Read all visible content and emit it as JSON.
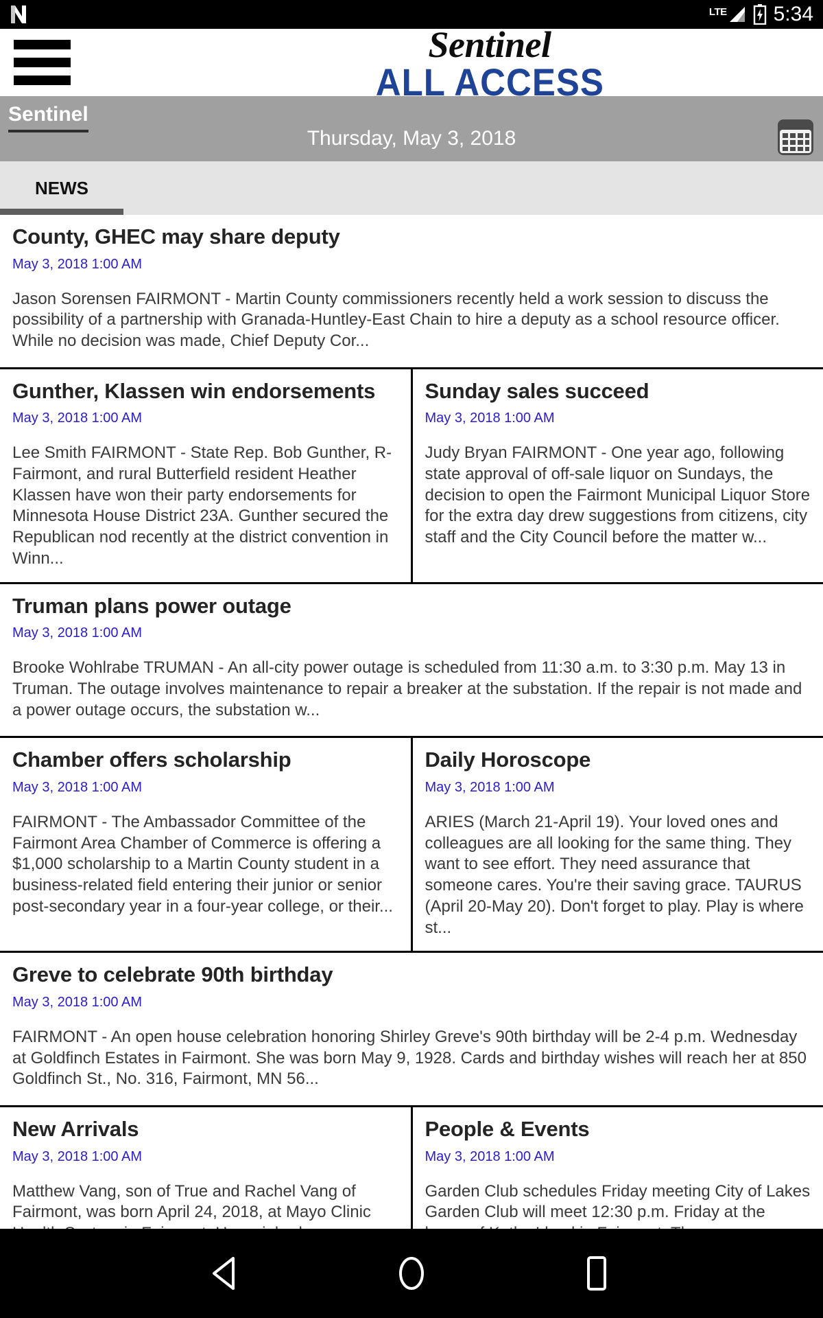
{
  "status_bar": {
    "app_icon": "netflix-n-icon",
    "network_label": "LTE",
    "signal_icon": "signal-bars-icon",
    "battery_icon": "battery-charging-icon",
    "time": "5:34"
  },
  "header": {
    "menu_icon": "hamburger-menu-icon",
    "logo_top": "Sentinel",
    "logo_bottom": "ALL ACCESS"
  },
  "navbar": {
    "section_label": "Sentinel",
    "date_label": "Thursday, May 3, 2018",
    "calendar_icon": "calendar-icon"
  },
  "tabs": [
    {
      "label": "NEWS",
      "active": true
    }
  ],
  "articles": [
    {
      "layout": "single",
      "items": [
        {
          "headline": "County, GHEC may share deputy",
          "timestamp": "May 3, 2018 1:00 AM",
          "excerpt": "Jason Sorensen FAIRMONT - Martin County commissioners recently held a work session to discuss the possibility of a partnership with Granada-Huntley-East Chain to hire a deputy as a school resource officer. While no decision was made, Chief Deputy Cor..."
        }
      ]
    },
    {
      "layout": "double",
      "items": [
        {
          "headline": "Gunther, Klassen win endorsements",
          "timestamp": "May 3, 2018 1:00 AM",
          "excerpt": "Lee Smith FAIRMONT - State Rep. Bob Gunther, R-Fairmont, and rural Butterfield resident Heather Klassen have won their party endorsements for Minnesota House District 23A. Gunther secured the Republican nod recently at the district convention in Winn..."
        },
        {
          "headline": "Sunday sales succeed",
          "timestamp": "May 3, 2018 1:00 AM",
          "excerpt": "Judy Bryan FAIRMONT - One year ago, following state approval of off-sale liquor on Sundays, the decision to open the Fairmont Municipal Liquor Store for the extra day drew suggestions from citizens, city staff and the City Council before the matter w..."
        }
      ]
    },
    {
      "layout": "single",
      "items": [
        {
          "headline": "Truman plans power outage",
          "timestamp": "May 3, 2018 1:00 AM",
          "excerpt": "Brooke Wohlrabe TRUMAN - An all-city power outage is scheduled from 11:30 a.m. to 3:30 p.m. May 13 in Truman. The outage involves maintenance to repair a breaker at the substation. If the repair is not made and a power outage occurs, the substation w..."
        }
      ]
    },
    {
      "layout": "double",
      "items": [
        {
          "headline": "Chamber offers scholarship",
          "timestamp": "May 3, 2018 1:00 AM",
          "excerpt": "FAIRMONT - The Ambassador Committee of the Fairmont Area Chamber of Commerce is offering a $1,000 scholarship to a Martin County student in a business-related field entering their junior or senior post-secondary year in a four-year college, or their..."
        },
        {
          "headline": "Daily Horoscope",
          "timestamp": "May 3, 2018 1:00 AM",
          "excerpt": "ARIES (March 21-April 19). Your loved ones and colleagues are all looking for the same thing. They want to see effort. They need assurance that someone cares. You're their saving grace. TAURUS (April 20-May 20). Don't forget to play. Play is where st..."
        }
      ]
    },
    {
      "layout": "single",
      "items": [
        {
          "headline": "Greve to celebrate 90th birthday",
          "timestamp": "May 3, 2018 1:00 AM",
          "excerpt": "FAIRMONT - An open house celebration honoring Shirley Greve's 90th birthday will be 2-4 p.m. Wednesday at Goldfinch Estates in Fairmont. She was born May 9, 1928. Cards and birthday wishes will reach her at 850 Goldfinch St., No. 316, Fairmont, MN 56..."
        }
      ]
    },
    {
      "layout": "double",
      "items": [
        {
          "headline": "New Arrivals",
          "timestamp": "May 3, 2018 1:00 AM",
          "excerpt": "Matthew Vang, son of True and Rachel Vang of Fairmont, was born April 24, 2018, at Mayo Clinic Health System in Fairmont. He weighed"
        },
        {
          "headline": "People & Events",
          "timestamp": "May 3, 2018 1:00 AM",
          "excerpt": "Garden Club schedules Friday meeting City of Lakes Garden Club will meet 12:30 p.m. Friday at the home of Kathy Lloyd in Fairmont. The"
        }
      ]
    }
  ],
  "android_nav": {
    "back_icon": "back-triangle-icon",
    "home_icon": "home-circle-icon",
    "recents_icon": "recents-square-icon"
  },
  "colors": {
    "accent_blue": "#1f4396",
    "timestamp": "#2b1ccc",
    "navbar_gray": "#a0a0a0",
    "tab_gray": "#e4e4e4",
    "tab_indicator": "#5d5d5d"
  }
}
